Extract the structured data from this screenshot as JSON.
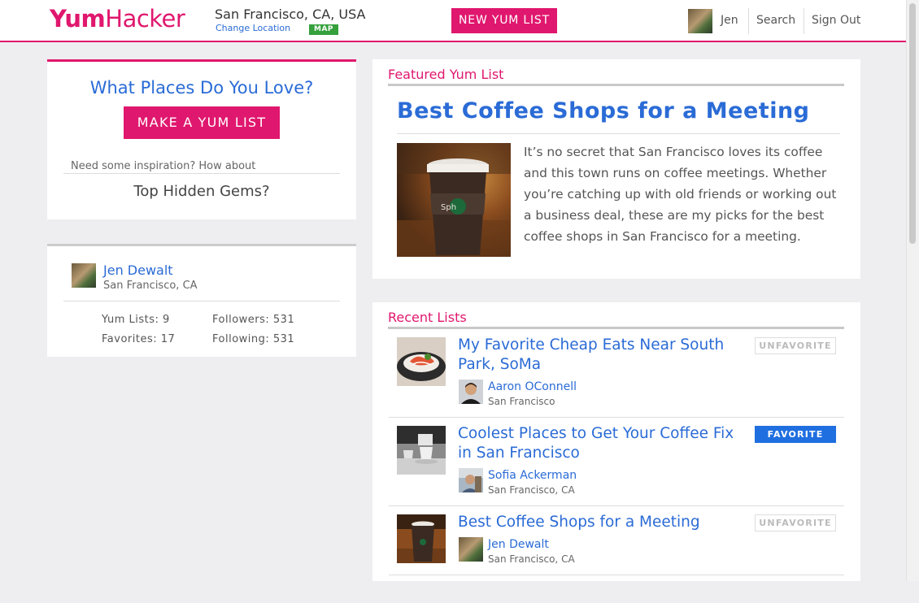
{
  "header": {
    "logo_part1": "Yum",
    "logo_part2": "Hacker",
    "location": "San Francisco, CA, USA",
    "change_location": "Change Location",
    "map_label": "MAP",
    "new_list_button": "NEW YUM LIST",
    "user_name": "Jen",
    "search": "Search",
    "sign_out": "Sign Out"
  },
  "love_card": {
    "title": "What Places Do You Love?",
    "make_button": "MAKE A YUM LIST",
    "inspiration": "Need some inspiration? How about",
    "suggestion": "Top Hidden Gems?"
  },
  "profile": {
    "name": "Jen Dewalt",
    "location": "San Francisco, CA",
    "yum_lists": "Yum Lists: 9",
    "favorites": "Favorites: 17",
    "followers": "Followers: 531",
    "following": "Following: 531"
  },
  "featured": {
    "section_title": "Featured Yum List",
    "title": "Best Coffee Shops for a Meeting",
    "description": "It’s no secret that San Francisco loves its coffee and this town runs on coffee meetings. Whether you’re catching up with old friends or working out a business deal, these are my picks for the best coffee shops in San Francisco for a meeting."
  },
  "recent": {
    "section_title": "Recent Lists",
    "items": [
      {
        "title": "My Favorite Cheap Eats Near South Park, SoMa",
        "author": "Aaron OConnell",
        "location": "San Francisco",
        "button": "UNFAVORITE",
        "state": "unfavorite"
      },
      {
        "title": "Coolest Places to Get Your Coffee Fix in San Francisco",
        "author": "Sofia Ackerman",
        "location": "San Francisco, CA",
        "button": "FAVORITE",
        "state": "favorite"
      },
      {
        "title": "Best Coffee Shops for a Meeting",
        "author": "Jen Dewalt",
        "location": "San Francisco, CA",
        "button": "UNFAVORITE",
        "state": "unfavorite"
      }
    ]
  },
  "colors": {
    "brand_pink": "#e0176e",
    "link_blue": "#2a6bd6",
    "favorite_blue": "#1f6fe0",
    "map_green": "#35a03c"
  }
}
